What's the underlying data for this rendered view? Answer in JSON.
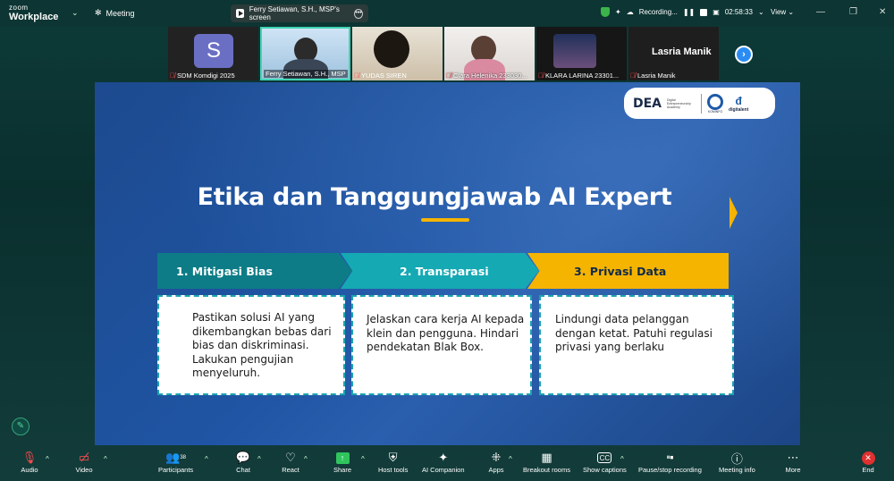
{
  "topbar": {
    "brand_line1": "zoom",
    "brand_line2": "Workplace",
    "meeting_label": "Meeting",
    "share_pill_label": "Ferry Setiawan, S.H., MSP's screen",
    "recording_label": "Recording...",
    "timer": "02:58:33",
    "view_label": "View"
  },
  "participants": [
    {
      "name": "SDM Komdigi 2025",
      "initial": "S",
      "muted": true
    },
    {
      "name": "Ferry Setiawan, S.H., MSP",
      "muted": false,
      "active": true
    },
    {
      "name": "YUDAS SIREN",
      "muted": true
    },
    {
      "name": "Clara Helenika 233030...",
      "muted": true
    },
    {
      "name": "KLARA LARINA 23301...",
      "muted": true
    },
    {
      "name": "Lasria Manik",
      "display_name": "Lasria Manik",
      "muted": true
    }
  ],
  "slide": {
    "logo_text": "DEA",
    "logo_sub": "Digital Entrepreneurship Academy",
    "logo_komdigi": "KOMINFO",
    "logo_dt": "digitalent",
    "title": "Etika dan Tanggungjawab AI Expert",
    "steps": [
      {
        "label": "1. Mitigasi Bias"
      },
      {
        "label": "2. Transparasi"
      },
      {
        "label": "3. Privasi Data"
      }
    ],
    "cards": [
      {
        "text": "Pastikan solusi AI yang dikembangkan bebas dari bias dan diskriminasi. Lakukan pengujian menyeluruh."
      },
      {
        "text": "Jelaskan cara kerja AI kepada klein dan pengguna. Hindari pendekatan Blak Box."
      },
      {
        "text": "Lindungi data pelanggan dengan ketat. Patuhi regulasi privasi yang berlaku"
      }
    ]
  },
  "toolbar": {
    "audio": "Audio",
    "video": "Video",
    "participants": "Participants",
    "participants_count": "38",
    "chat": "Chat",
    "react": "React",
    "share": "Share",
    "host_tools": "Host tools",
    "ai_companion": "AI Companion",
    "apps": "Apps",
    "breakout_rooms": "Breakout rooms",
    "show_captions": "Show captions",
    "pause_recording": "Pause/stop recording",
    "meeting_info": "Meeting info",
    "more": "More",
    "end": "End"
  },
  "colors": {
    "accent_teal": "#0d7c86",
    "accent_cyan": "#15a9b4",
    "accent_yellow": "#f5b400",
    "share_green": "#2fc45c",
    "end_red": "#e0302f"
  }
}
